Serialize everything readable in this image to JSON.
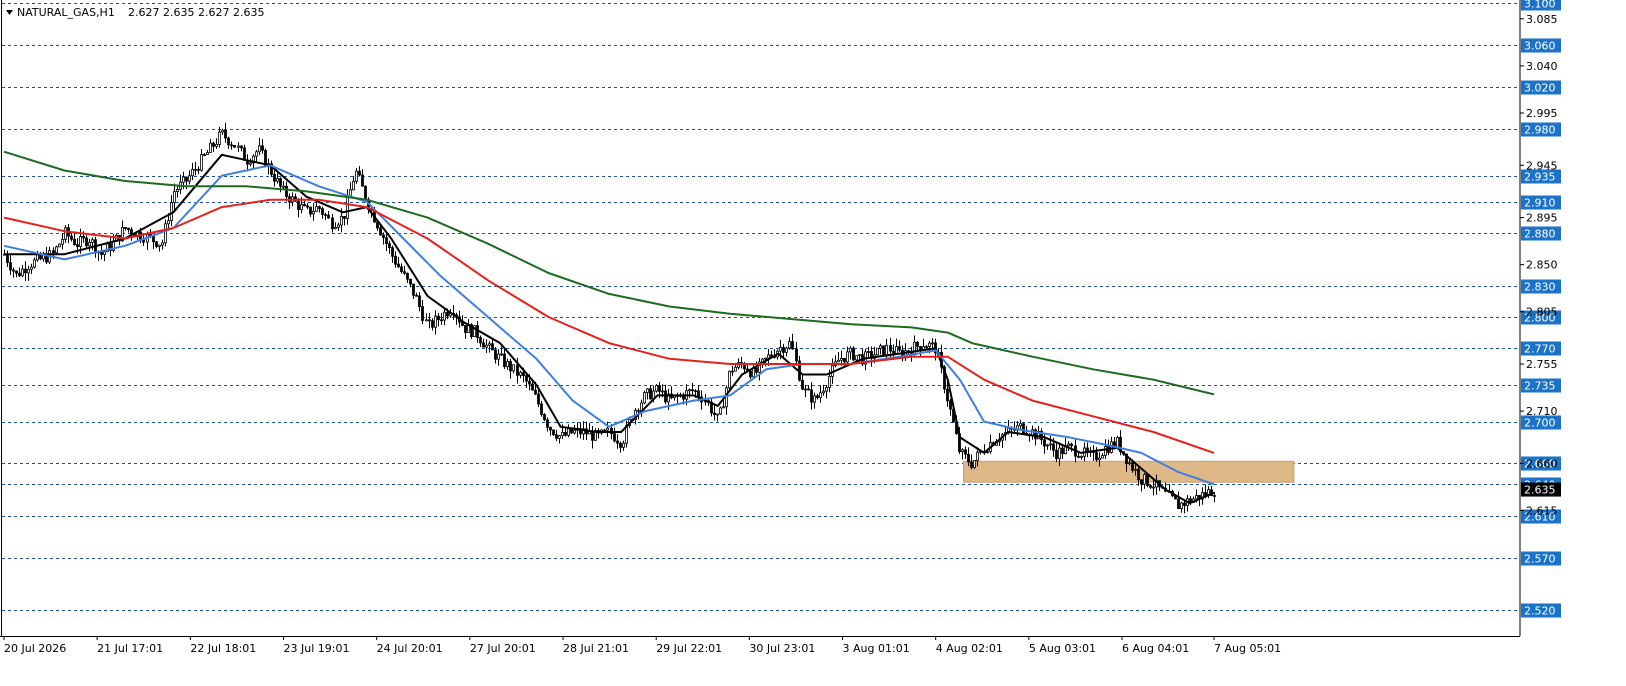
{
  "chart_data": {
    "type": "candlestick",
    "header": {
      "symbol": "NATURAL_GAS,H1",
      "open": "2.627",
      "high": "2.635",
      "low": "2.627",
      "close": "2.635"
    },
    "y_range": [
      2.495,
      3.103
    ],
    "x_range": [
      0,
      100
    ],
    "y_axis_ticks": [
      "3.085",
      "3.040",
      "2.995",
      "2.945",
      "2.895",
      "2.850",
      "2.805",
      "2.755",
      "2.710",
      "2.660",
      "2.615"
    ],
    "price_levels": [
      3.1,
      3.06,
      3.02,
      2.98,
      2.935,
      2.91,
      2.88,
      2.83,
      2.8,
      2.77,
      2.735,
      2.7,
      2.66,
      2.64,
      2.61,
      2.57,
      2.52
    ],
    "price_level_labels": [
      "3.100",
      "3.060",
      "3.020",
      "2.980",
      "2.935",
      "2.910",
      "2.880",
      "2.830",
      "2.800",
      "2.770",
      "2.735",
      "2.700",
      "2.660",
      "2.640",
      "2.610",
      "2.570",
      "2.520"
    ],
    "x_axis_labels": [
      {
        "label": "20 Jul 2026",
        "x": 0
      },
      {
        "label": "21 Jul 17:01",
        "x": 7.7
      },
      {
        "label": "22 Jul 18:01",
        "x": 15.4
      },
      {
        "label": "23 Jul 19:01",
        "x": 23.1
      },
      {
        "label": "24 Jul 20:01",
        "x": 30.8
      },
      {
        "label": "27 Jul 20:01",
        "x": 38.5
      },
      {
        "label": "28 Jul 21:01",
        "x": 46.2
      },
      {
        "label": "29 Jul 22:01",
        "x": 53.9
      },
      {
        "label": "30 Jul 23:01",
        "x": 61.6
      },
      {
        "label": "3 Aug 01:01",
        "x": 69.3
      },
      {
        "label": "4 Aug 02:01",
        "x": 77.0
      },
      {
        "label": "5 Aug 03:01",
        "x": 84.7
      },
      {
        "label": "6 Aug 04:01",
        "x": 92.4
      },
      {
        "label": "7 Aug 05:01",
        "x": 100.0
      }
    ],
    "price_path": [
      [
        0,
        2.86
      ],
      [
        1,
        2.84
      ],
      [
        2,
        2.85
      ],
      [
        3,
        2.855
      ],
      [
        4,
        2.86
      ],
      [
        5,
        2.88
      ],
      [
        6,
        2.87
      ],
      [
        7,
        2.875
      ],
      [
        8,
        2.86
      ],
      [
        9,
        2.87
      ],
      [
        10,
        2.885
      ],
      [
        11,
        2.88
      ],
      [
        12,
        2.875
      ],
      [
        13,
        2.87
      ],
      [
        14,
        2.92
      ],
      [
        15,
        2.93
      ],
      [
        16,
        2.945
      ],
      [
        17,
        2.96
      ],
      [
        18,
        2.975
      ],
      [
        19,
        2.965
      ],
      [
        20,
        2.95
      ],
      [
        21,
        2.96
      ],
      [
        22,
        2.94
      ],
      [
        23,
        2.92
      ],
      [
        24,
        2.91
      ],
      [
        25,
        2.9
      ],
      [
        26,
        2.905
      ],
      [
        27,
        2.89
      ],
      [
        28,
        2.895
      ],
      [
        29,
        2.94
      ],
      [
        30,
        2.91
      ],
      [
        31,
        2.885
      ],
      [
        32,
        2.86
      ],
      [
        33,
        2.84
      ],
      [
        34,
        2.82
      ],
      [
        35,
        2.79
      ],
      [
        36,
        2.8
      ],
      [
        37,
        2.81
      ],
      [
        38,
        2.79
      ],
      [
        39,
        2.785
      ],
      [
        40,
        2.77
      ],
      [
        41,
        2.76
      ],
      [
        42,
        2.75
      ],
      [
        43,
        2.74
      ],
      [
        44,
        2.72
      ],
      [
        45,
        2.695
      ],
      [
        46,
        2.685
      ],
      [
        47,
        2.69
      ],
      [
        48,
        2.69
      ],
      [
        49,
        2.685
      ],
      [
        50,
        2.69
      ],
      [
        51,
        2.68
      ],
      [
        52,
        2.71
      ],
      [
        53,
        2.725
      ],
      [
        54,
        2.73
      ],
      [
        55,
        2.72
      ],
      [
        56,
        2.725
      ],
      [
        57,
        2.73
      ],
      [
        58,
        2.72
      ],
      [
        59,
        2.7
      ],
      [
        60,
        2.75
      ],
      [
        61,
        2.755
      ],
      [
        62,
        2.745
      ],
      [
        63,
        2.76
      ],
      [
        64,
        2.77
      ],
      [
        65,
        2.775
      ],
      [
        66,
        2.73
      ],
      [
        67,
        2.72
      ],
      [
        68,
        2.74
      ],
      [
        69,
        2.76
      ],
      [
        70,
        2.765
      ],
      [
        71,
        2.76
      ],
      [
        72,
        2.765
      ],
      [
        73,
        2.77
      ],
      [
        74,
        2.765
      ],
      [
        75,
        2.77
      ],
      [
        76,
        2.775
      ],
      [
        77,
        2.77
      ],
      [
        78,
        2.72
      ],
      [
        79,
        2.67
      ],
      [
        80,
        2.66
      ],
      [
        81,
        2.675
      ],
      [
        82,
        2.685
      ],
      [
        83,
        2.69
      ],
      [
        84,
        2.695
      ],
      [
        85,
        2.69
      ],
      [
        86,
        2.68
      ],
      [
        87,
        2.67
      ],
      [
        88,
        2.675
      ],
      [
        89,
        2.67
      ],
      [
        90,
        2.665
      ],
      [
        91,
        2.675
      ],
      [
        92,
        2.68
      ],
      [
        93,
        2.66
      ],
      [
        94,
        2.645
      ],
      [
        95,
        2.64
      ],
      [
        96,
        2.63
      ],
      [
        97,
        2.62
      ],
      [
        98,
        2.625
      ],
      [
        99,
        2.63
      ],
      [
        100,
        2.635
      ]
    ],
    "series": [
      {
        "color": "#000000",
        "points": [
          [
            0,
            2.86
          ],
          [
            5,
            2.86
          ],
          [
            10,
            2.875
          ],
          [
            14,
            2.9
          ],
          [
            18,
            2.955
          ],
          [
            22,
            2.945
          ],
          [
            25,
            2.915
          ],
          [
            28,
            2.9
          ],
          [
            30,
            2.905
          ],
          [
            32,
            2.875
          ],
          [
            35,
            2.82
          ],
          [
            38,
            2.795
          ],
          [
            41,
            2.775
          ],
          [
            44,
            2.735
          ],
          [
            46,
            2.695
          ],
          [
            49,
            2.69
          ],
          [
            51,
            2.69
          ],
          [
            54,
            2.725
          ],
          [
            57,
            2.725
          ],
          [
            59,
            2.715
          ],
          [
            61,
            2.745
          ],
          [
            64,
            2.765
          ],
          [
            66,
            2.745
          ],
          [
            68,
            2.745
          ],
          [
            71,
            2.76
          ],
          [
            74,
            2.765
          ],
          [
            77,
            2.77
          ],
          [
            78,
            2.74
          ],
          [
            79,
            2.685
          ],
          [
            81,
            2.67
          ],
          [
            83,
            2.69
          ],
          [
            86,
            2.685
          ],
          [
            89,
            2.67
          ],
          [
            92,
            2.675
          ],
          [
            94,
            2.655
          ],
          [
            96,
            2.635
          ],
          [
            98,
            2.622
          ],
          [
            100,
            2.632
          ]
        ]
      },
      {
        "color": "#3f7fe0",
        "points": [
          [
            0,
            2.868
          ],
          [
            5,
            2.855
          ],
          [
            10,
            2.868
          ],
          [
            14,
            2.885
          ],
          [
            18,
            2.935
          ],
          [
            22,
            2.945
          ],
          [
            26,
            2.925
          ],
          [
            30,
            2.91
          ],
          [
            33,
            2.875
          ],
          [
            36,
            2.84
          ],
          [
            40,
            2.8
          ],
          [
            44,
            2.76
          ],
          [
            47,
            2.72
          ],
          [
            50,
            2.695
          ],
          [
            53,
            2.71
          ],
          [
            57,
            2.72
          ],
          [
            60,
            2.725
          ],
          [
            63,
            2.75
          ],
          [
            66,
            2.755
          ],
          [
            70,
            2.755
          ],
          [
            74,
            2.762
          ],
          [
            77,
            2.768
          ],
          [
            79,
            2.74
          ],
          [
            81,
            2.7
          ],
          [
            84,
            2.692
          ],
          [
            88,
            2.685
          ],
          [
            91,
            2.678
          ],
          [
            94,
            2.67
          ],
          [
            97,
            2.652
          ],
          [
            100,
            2.64
          ]
        ]
      },
      {
        "color": "#e8201c",
        "points": [
          [
            0,
            2.895
          ],
          [
            5,
            2.882
          ],
          [
            10,
            2.875
          ],
          [
            14,
            2.885
          ],
          [
            18,
            2.905
          ],
          [
            22,
            2.912
          ],
          [
            26,
            2.912
          ],
          [
            30,
            2.905
          ],
          [
            35,
            2.875
          ],
          [
            40,
            2.835
          ],
          [
            45,
            2.8
          ],
          [
            50,
            2.775
          ],
          [
            55,
            2.76
          ],
          [
            60,
            2.755
          ],
          [
            65,
            2.755
          ],
          [
            70,
            2.755
          ],
          [
            75,
            2.762
          ],
          [
            78,
            2.762
          ],
          [
            81,
            2.74
          ],
          [
            85,
            2.72
          ],
          [
            90,
            2.705
          ],
          [
            95,
            2.69
          ],
          [
            100,
            2.67
          ]
        ]
      },
      {
        "color": "#1e6b1e",
        "points": [
          [
            0,
            2.958
          ],
          [
            5,
            2.94
          ],
          [
            10,
            2.93
          ],
          [
            15,
            2.925
          ],
          [
            20,
            2.925
          ],
          [
            25,
            2.92
          ],
          [
            30,
            2.912
          ],
          [
            35,
            2.895
          ],
          [
            40,
            2.87
          ],
          [
            45,
            2.842
          ],
          [
            50,
            2.822
          ],
          [
            55,
            2.81
          ],
          [
            60,
            2.803
          ],
          [
            65,
            2.798
          ],
          [
            70,
            2.793
          ],
          [
            75,
            2.79
          ],
          [
            78,
            2.785
          ],
          [
            80,
            2.775
          ],
          [
            85,
            2.762
          ],
          [
            90,
            2.75
          ],
          [
            95,
            2.74
          ],
          [
            100,
            2.726
          ]
        ]
      }
    ],
    "zone": {
      "x_start": 79.3,
      "x_end": 106.6,
      "y_low": 2.642,
      "y_high": 2.662,
      "color": "#deb887"
    },
    "current_price_tag": "2.635"
  }
}
